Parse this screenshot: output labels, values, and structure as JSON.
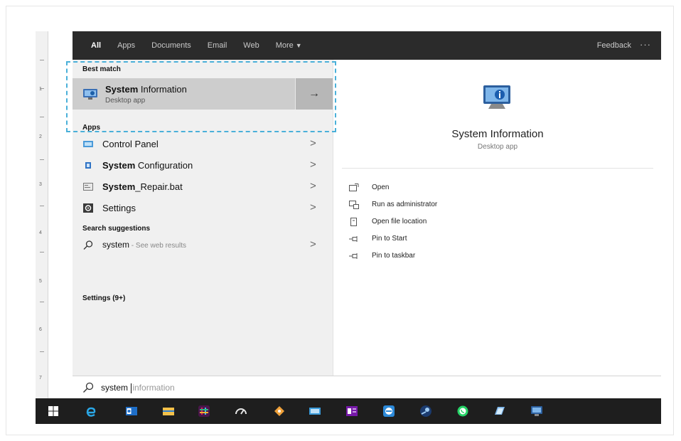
{
  "topbar": {
    "tabs": [
      {
        "label": "All",
        "active": true
      },
      {
        "label": "Apps",
        "active": false
      },
      {
        "label": "Documents",
        "active": false
      },
      {
        "label": "Email",
        "active": false
      },
      {
        "label": "Web",
        "active": false
      },
      {
        "label": "More",
        "active": false
      }
    ],
    "more_caret": "▼",
    "feedback": "Feedback",
    "more_options": "···"
  },
  "best_match": {
    "heading": "Best match",
    "title_bold": "System",
    "title_rest": " Information",
    "subtitle": "Desktop app",
    "arrow": "→"
  },
  "apps": {
    "heading": "Apps",
    "items": [
      {
        "bold": "",
        "rest": "Control Panel",
        "icon": "control-panel-icon",
        "chevron": ">"
      },
      {
        "bold": "System",
        "rest": " Configuration",
        "icon": "system-configuration-icon",
        "chevron": ">"
      },
      {
        "bold": "System",
        "rest": "_Repair.bat",
        "icon": "batch-file-icon",
        "chevron": ">"
      },
      {
        "bold": "",
        "rest": "Settings",
        "icon": "settings-gear-icon",
        "chevron": ">"
      }
    ]
  },
  "suggestions": {
    "heading": "Search suggestions",
    "items": [
      {
        "text": "system",
        "hint": " - See web results",
        "chevron": ">"
      }
    ]
  },
  "settings_count": "Settings (9+)",
  "preview": {
    "title": "System Information",
    "subtitle": "Desktop app",
    "actions": [
      {
        "label": "Open",
        "icon": "open-icon"
      },
      {
        "label": "Run as administrator",
        "icon": "run-as-admin-icon"
      },
      {
        "label": "Open file location",
        "icon": "file-location-icon"
      },
      {
        "label": "Pin to Start",
        "icon": "pin-icon"
      },
      {
        "label": "Pin to taskbar",
        "icon": "pin-icon"
      }
    ]
  },
  "search": {
    "typed": "system ",
    "completion": "information"
  },
  "ruler_numbers": [
    "1",
    "2",
    "3",
    "4",
    "5",
    "6",
    "7"
  ],
  "ruler_scroll": "<",
  "taskbar": {
    "icons": [
      "windows-start-icon",
      "edge-icon",
      "outlook-icon",
      "file-explorer-icon",
      "slack-icon",
      "speedometer-icon",
      "tag-app-icon",
      "control-panel-icon",
      "onenote-icon",
      "remote-desktop-icon",
      "steam-icon",
      "whatsapp-icon",
      "notepad-icon",
      "system-information-icon"
    ]
  },
  "colors": {
    "topbar": "#2b2b2b",
    "results_background": "#f0f0f0",
    "best_match_highlight": "#cdcdcd",
    "selection_dash": "#4ab0d9",
    "taskbar": "#1e1e1e"
  }
}
